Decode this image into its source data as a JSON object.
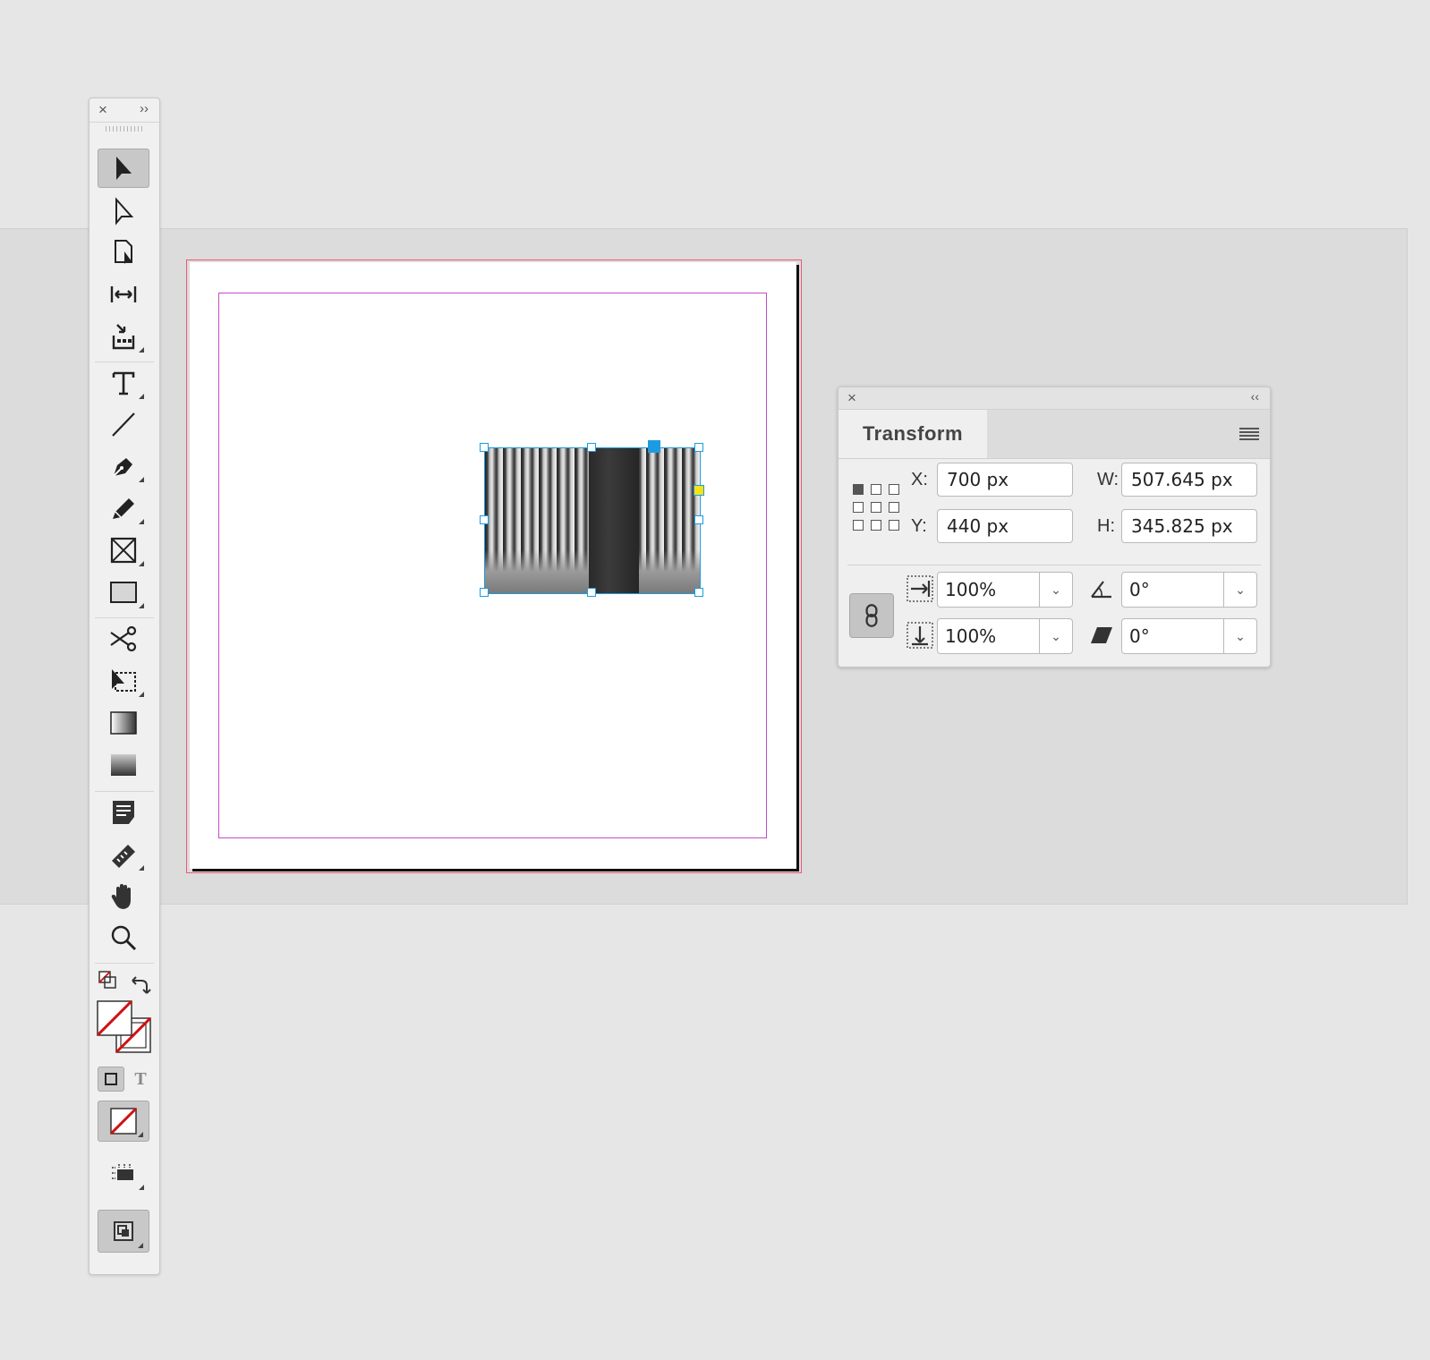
{
  "toolbar": {
    "close_glyph": "×",
    "expand_glyph": "››",
    "tools": [
      {
        "name": "selection-tool-icon"
      },
      {
        "name": "direct-selection-tool-icon"
      },
      {
        "name": "page-tool-icon"
      },
      {
        "name": "gap-tool-icon"
      },
      {
        "name": "content-collector-tool-icon"
      },
      {
        "name": "type-tool-icon"
      },
      {
        "name": "line-tool-icon"
      },
      {
        "name": "pen-tool-icon"
      },
      {
        "name": "pencil-tool-icon"
      },
      {
        "name": "rectangle-frame-tool-icon"
      },
      {
        "name": "rectangle-tool-icon"
      },
      {
        "name": "scissors-tool-icon"
      },
      {
        "name": "free-transform-tool-icon"
      },
      {
        "name": "gradient-swatch-tool-icon"
      },
      {
        "name": "gradient-feather-tool-icon"
      },
      {
        "name": "note-tool-icon"
      },
      {
        "name": "measure-tool-icon"
      },
      {
        "name": "hand-tool-icon"
      },
      {
        "name": "zoom-tool-icon"
      }
    ],
    "formatting_text_glyph": "T"
  },
  "transform_panel": {
    "close_glyph": "×",
    "collapse_glyph": "‹‹",
    "title": "Transform",
    "x_label": "X:",
    "x_value": "700 px",
    "y_label": "Y:",
    "y_value": "440 px",
    "w_label": "W:",
    "w_value": "507.645 px",
    "h_label": "H:",
    "h_value": "345.825 px",
    "scale_x": "100%",
    "scale_y": "100%",
    "rotation": "0°",
    "shear": "0°"
  },
  "colors": {
    "selection": "#1e9be0",
    "margin_guide": "#c24dc7",
    "bleed_guide": "#e8597a",
    "center_point": "#1e9be0",
    "anchor_point": "#f7e11b"
  }
}
